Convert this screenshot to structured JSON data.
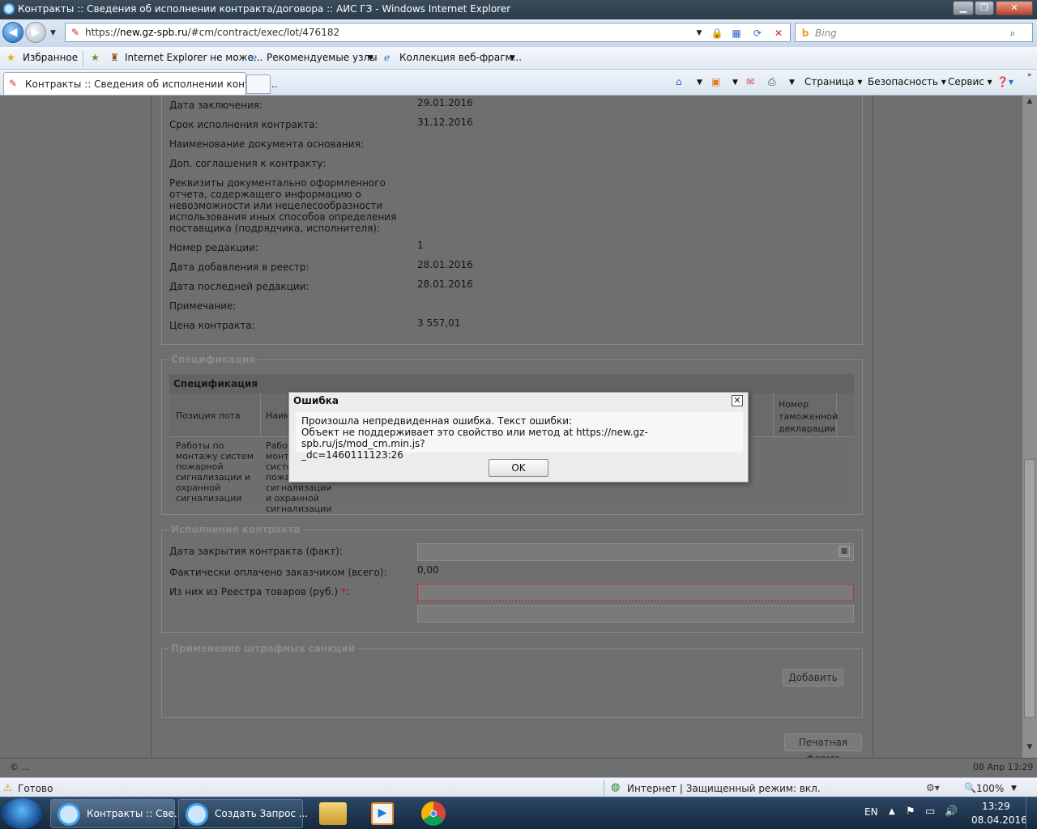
{
  "window": {
    "title": "Контракты :: Сведения об исполнении контракта/договора :: АИС ГЗ - Windows Internet Explorer"
  },
  "address": {
    "url_prefix": "https://",
    "url_host": "new.gz-spb.ru",
    "url_path": "/#cm/contract/exec/lot/476182",
    "search_placeholder": "Bing"
  },
  "favorites": {
    "label": "Избранное",
    "items": [
      "Internet Explorer не може...",
      "Рекомендуемые узлы",
      "Коллекция веб-фрагм..."
    ]
  },
  "tab": {
    "label": "Контракты :: Сведения об исполнении контрак..."
  },
  "commandbar": {
    "page": "Страница",
    "safety": "Безопасность",
    "tools": "Сервис"
  },
  "details": [
    {
      "label": "Дата заключения:",
      "value": "29.01.2016"
    },
    {
      "label": "Срок исполнения контракта:",
      "value": "31.12.2016"
    },
    {
      "label": "Наименование документа основания:",
      "value": ""
    },
    {
      "label": "Доп. соглашения к контракту:",
      "value": ""
    },
    {
      "label": "Реквизиты документально оформленного отчета, содержащего информацию о невозможности или нецелесообразности использования иных способов определения поставщика (подрядчика, исполнителя):",
      "value": ""
    },
    {
      "label": "Номер редакции:",
      "value": "1"
    },
    {
      "label": "Дата добавления в реестр:",
      "value": "28.01.2016"
    },
    {
      "label": "Дата последней редакции:",
      "value": "28.01.2016"
    },
    {
      "label": "Примечание:",
      "value": ""
    },
    {
      "label": "Цена контракта:",
      "value": "3 557,01"
    }
  ],
  "spec": {
    "legend": "Спецификация",
    "grid_title": "Спецификация",
    "columns": [
      "Позиция лота",
      "Наим",
      "Номер таможенной декларации"
    ],
    "row": [
      "Работы по монтажу систем пожарной сигнализации и охранной сигнализации",
      "Работы по монтажу систем пожарной сигнализации и охранной сигнализации"
    ]
  },
  "execution": {
    "legend": "Исполнение контракта",
    "close_date_label": "Дата закрытия контракта (факт):",
    "paid_label": "Фактически оплачено заказчиком (всего):",
    "paid_value": "0,00",
    "registry_label": "Из них из Реестра товаров (руб.)",
    "required_mark": "*",
    "colon": ":"
  },
  "penalties": {
    "legend": "Применение штрафных санкций",
    "add_button": "Добавить"
  },
  "print_button": "Печатная форма",
  "statusline": {
    "left": "© ...",
    "right": "08 Апр 13:29"
  },
  "dialog": {
    "title": "Ошибка",
    "message_line1": "Произошла непредвиденная ошибка. Текст ошибки:",
    "message_line2": "Объект не поддерживает это свойство или метод at https://new.gz-spb.ru/js/mod_cm.min.js?",
    "message_line3": "_dc=1460111123:26",
    "ok": "OK"
  },
  "iestatus": {
    "left": "Готово",
    "zone": "Интернет | Защищенный режим: вкл.",
    "zoom": "100%"
  },
  "taskbar": {
    "tasks": [
      "Контракты :: Све...",
      "Создать Запрос ..."
    ],
    "lang": "EN",
    "time": "13:29",
    "date": "08.04.2016"
  },
  "colors": {
    "accent": "#1763b8",
    "required": "#cc2222",
    "overlay": "#6f6f6f"
  }
}
